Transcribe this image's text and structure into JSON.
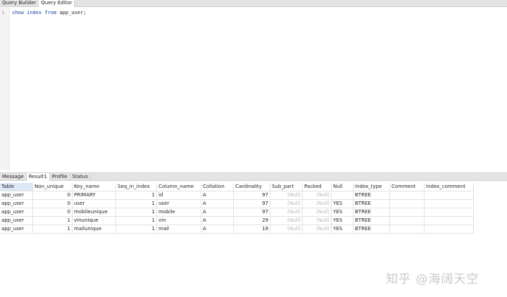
{
  "top_tabs": [
    {
      "label": "Query Builder",
      "active": false
    },
    {
      "label": "Query Editor",
      "active": true
    }
  ],
  "editor": {
    "line_number": "1",
    "tokens": [
      {
        "text": "show",
        "kind": "keyword"
      },
      {
        "text": " ",
        "kind": "plain"
      },
      {
        "text": "index",
        "kind": "keyword"
      },
      {
        "text": " ",
        "kind": "plain"
      },
      {
        "text": "from",
        "kind": "keyword"
      },
      {
        "text": " app_user;",
        "kind": "plain"
      }
    ]
  },
  "result_tabs": [
    {
      "label": "Message",
      "active": false
    },
    {
      "label": "Result1",
      "active": true
    },
    {
      "label": "Profile",
      "active": false
    },
    {
      "label": "Status",
      "active": false
    }
  ],
  "result": {
    "columns": [
      "Table",
      "Non_unique",
      "Key_name",
      "Seq_in_index",
      "Column_name",
      "Collation",
      "Cardinality",
      "Sub_part",
      "Packed",
      "Null",
      "Index_type",
      "Comment",
      "Index_comment"
    ],
    "rows": [
      [
        "app_user",
        "0",
        "PRIMARY",
        "1",
        "id",
        "A",
        "97",
        "(Null)",
        "(Null)",
        "",
        "BTREE",
        "",
        ""
      ],
      [
        "app_user",
        "0",
        "user",
        "1",
        "user",
        "A",
        "97",
        "(Null)",
        "(Null)",
        "YES",
        "BTREE",
        "",
        ""
      ],
      [
        "app_user",
        "0",
        "mobileunique",
        "1",
        "mobile",
        "A",
        "97",
        "(Null)",
        "(Null)",
        "YES",
        "BTREE",
        "",
        ""
      ],
      [
        "app_user",
        "1",
        "vinunique",
        "1",
        "vin",
        "A",
        "29",
        "(Null)",
        "(Null)",
        "YES",
        "BTREE",
        "",
        ""
      ],
      [
        "app_user",
        "1",
        "mailunique",
        "1",
        "mail",
        "A",
        "19",
        "(Null)",
        "(Null)",
        "YES",
        "BTREE",
        "",
        ""
      ]
    ]
  },
  "watermark": "知乎 @海阔天空"
}
